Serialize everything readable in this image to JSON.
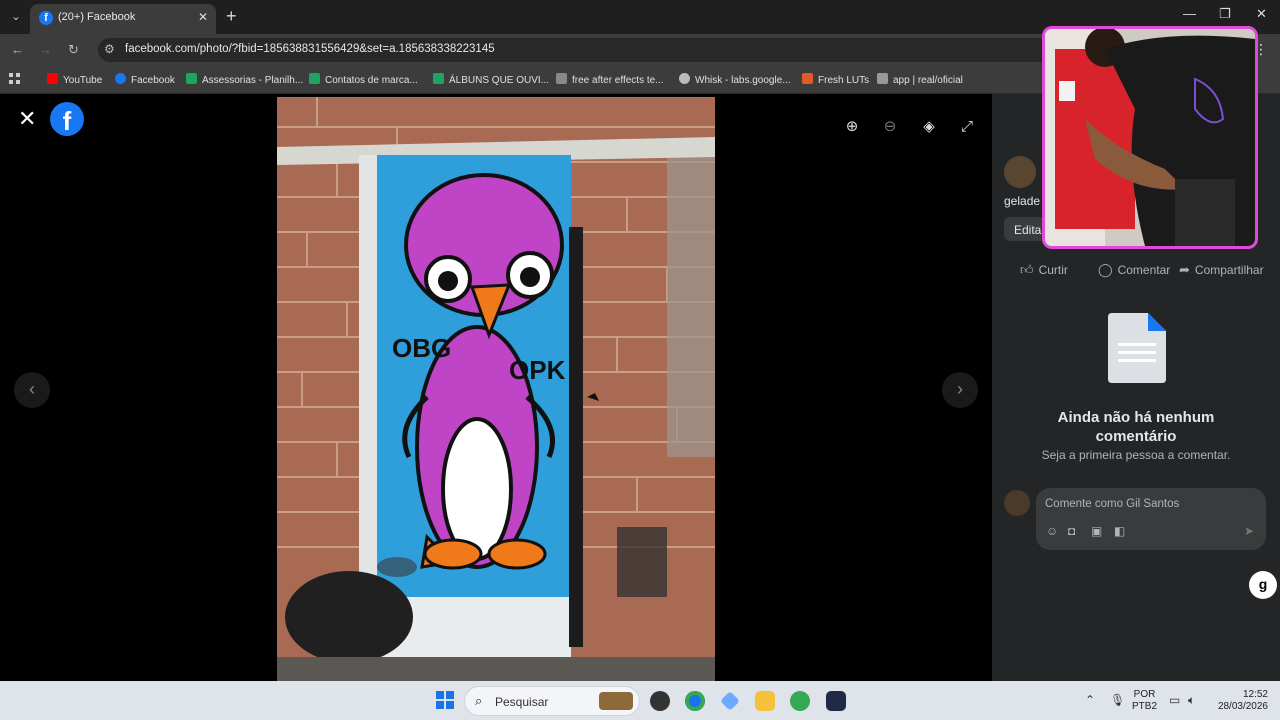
{
  "browser": {
    "tab_title": "(20+) Facebook",
    "url": "facebook.com/photo/?fbid=185638831556429&set=a.185638338223145",
    "bookmarks": [
      {
        "label": "YouTube",
        "color": "#ff0000"
      },
      {
        "label": "Facebook",
        "color": "#1877f2"
      },
      {
        "label": "Assessorias - Planilh...",
        "color": "#1ea362"
      },
      {
        "label": "Contatos de marca...",
        "color": "#1ea362"
      },
      {
        "label": "ÁLBUNS QUE OUVI...",
        "color": "#1ea362"
      },
      {
        "label": "free after effects te...",
        "color": "#888888"
      },
      {
        "label": "Whisk - labs.google...",
        "color": "#bbbbbb"
      },
      {
        "label": "Fresh LUTs",
        "color": "#e05a2a"
      },
      {
        "label": "app | real/oficial",
        "color": "#999999"
      }
    ]
  },
  "panel": {
    "author_name": "gelade",
    "edit_label": "Edita",
    "actions": {
      "like": "Curtir",
      "comment": "Comentar",
      "share": "Compartilhar"
    },
    "no_comments_title": "Ainda não há nenhum comentário",
    "no_comments_sub": "Seja a primeira pessoa a comentar.",
    "comment_placeholder": "Comente como Gil Santos"
  },
  "photo": {
    "graffiti_left": "OBG",
    "graffiti_right": "OPK"
  },
  "taskbar": {
    "search_label": "Pesquisar",
    "lang_top": "POR",
    "lang_bottom": "PTB2",
    "time": "12:52",
    "date": "28/03/2026"
  }
}
